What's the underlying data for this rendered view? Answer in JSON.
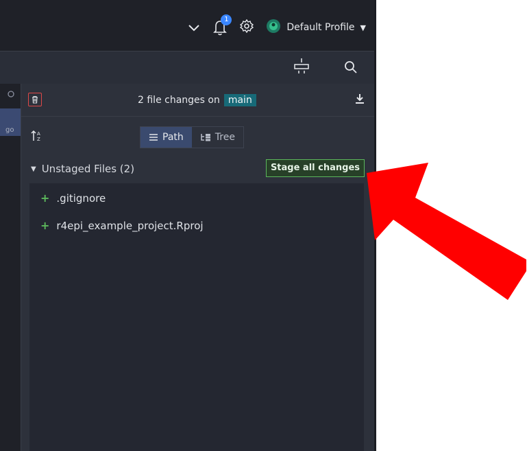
{
  "topbar": {
    "notification_count": "1",
    "profile_name": "Default Profile"
  },
  "left_strip": {
    "truncated_text": "go"
  },
  "panel": {
    "changes_prefix": "2 file changes on",
    "branch": "main",
    "view_toggle": [
      {
        "label": "Path",
        "active": true
      },
      {
        "label": "Tree",
        "active": false
      }
    ],
    "section_title": "Unstaged Files (2)",
    "stage_all_label": "Stage all changes",
    "files": [
      {
        "name": ".gitignore",
        "status": "added"
      },
      {
        "name": "r4epi_example_project.Rproj",
        "status": "added"
      }
    ]
  },
  "colors": {
    "annotation_arrow": "#ff0000",
    "added": "#5cb85c",
    "branch_chip": "#176a78"
  }
}
